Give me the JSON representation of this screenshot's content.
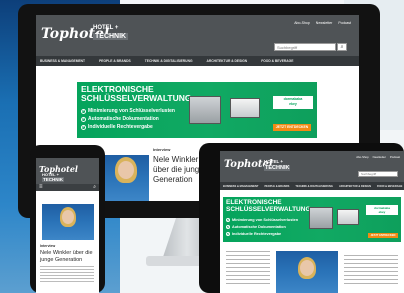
{
  "brand": {
    "logo_main": "Tophotel",
    "logo_sub_top": "HOTEL +",
    "logo_sub_bottom": "TECHNIK"
  },
  "header_links": [
    "Abo-Shop",
    "Newsletter",
    "Podcast"
  ],
  "search": {
    "placeholder": "Suchbegriff"
  },
  "nav": [
    "BUSINESS & MANAGEMENT",
    "PEOPLE & BRANDS",
    "TECHNIK & DIGITALISIERUNG",
    "ARCHITEKTUR & DESIGN",
    "FOOD & BEVERAGE"
  ],
  "tablet_nav": [
    "BUSINESS & MANAGEMENT",
    "PEOPLE & BRANDS",
    "TECHNIK & DIGITALISIERUNG",
    "ARCHITEKTUR & DESIGN",
    "FOOD & BEVERAGE"
  ],
  "banner": {
    "title_line1": "ELEKTRONISCHE",
    "title_line2": "SCHLÜSSELVERWALTUNG",
    "items": [
      "Minimierung von Schlüsselverlusten",
      "Automatische Dokumentation",
      "Individuelle Rechtevergabe"
    ],
    "cta": "JETZT ENTDECKEN",
    "sponsor_line1": "dormakaba",
    "sponsor_line2": "ekey"
  },
  "article": {
    "category": "Interview",
    "headline_monitor": "Nele Winkler über die junge Generation",
    "headline_phone": "Nele Winkler über die junge Generation"
  },
  "colors": {
    "header": "#4f5356",
    "nav": "#34383b",
    "banner_green": "#05a45c",
    "cta_orange": "#f28a14"
  }
}
